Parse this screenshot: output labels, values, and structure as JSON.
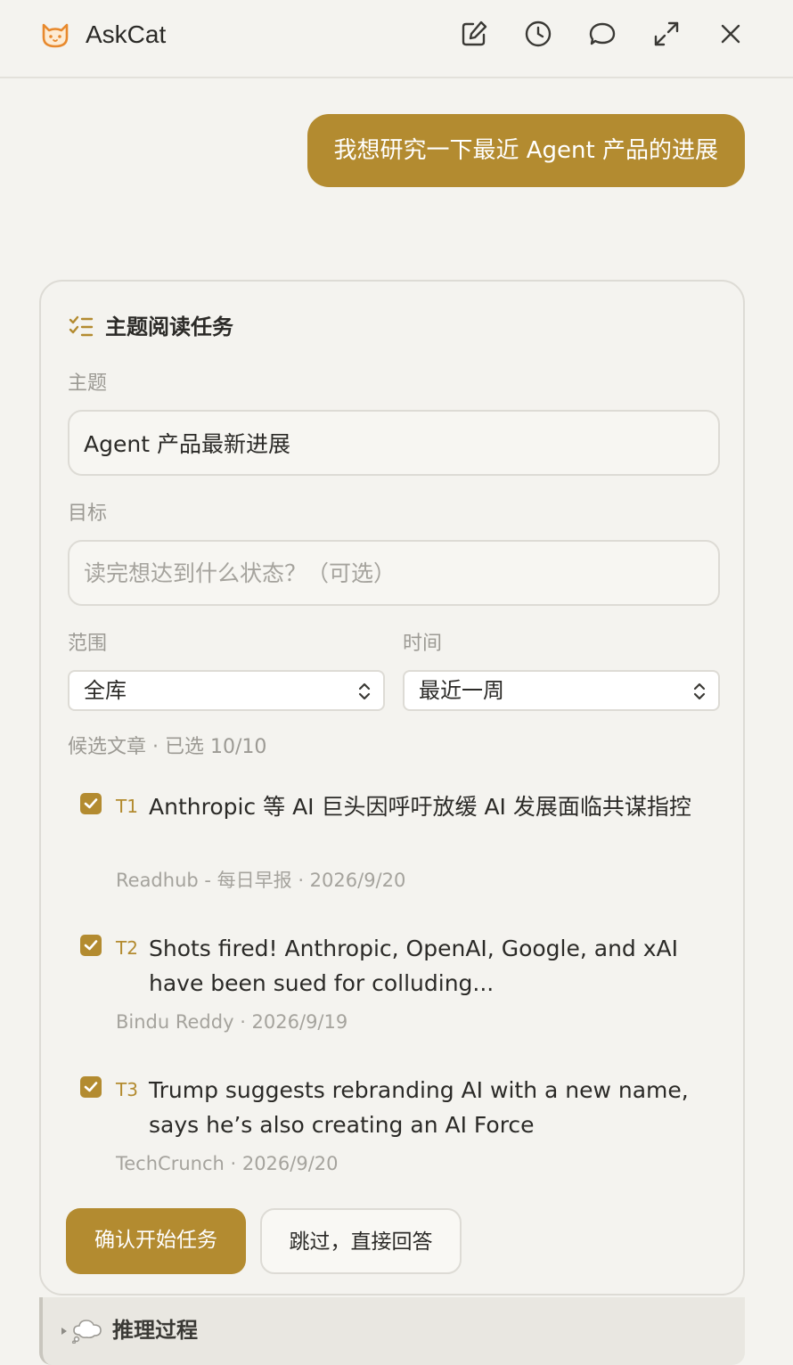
{
  "header": {
    "app_name": "AskCat",
    "icons": [
      "cat-logo-icon",
      "edit-icon",
      "history-icon",
      "chat-icon",
      "expand-icon",
      "close-icon"
    ]
  },
  "user_message": "我想研究一下最近 Agent 产品的进展",
  "task_card": {
    "title": "主题阅读任务",
    "topic_label": "主题",
    "topic_value": "Agent 产品最新进展",
    "goal_label": "目标",
    "goal_placeholder": "读完想达到什么状态？（可选）",
    "scope_label": "范围",
    "scope_value": "全库",
    "time_label": "时间",
    "time_value": "最近一周",
    "candidates_label": "候选文章 · 已选 10/10",
    "articles": [
      {
        "id": "T1",
        "title": "Anthropic 等 AI 巨头因呼吁放缓 AI 发展面临共谋指控",
        "meta": "Readhub - 每日早报 · 2026/9/20",
        "checked": true
      },
      {
        "id": "T2",
        "title": "Shots fired! Anthropic, OpenAI, Google, and xAI have been sued for colluding...",
        "meta": "Bindu Reddy · 2026/9/19",
        "checked": true
      },
      {
        "id": "T3",
        "title": "Trump suggests rebranding AI with a new name, says he’s also creating an AI Force",
        "meta": "TechCrunch · 2026/9/20",
        "checked": true
      }
    ],
    "confirm_label": "确认开始任务",
    "skip_label": "跳过，直接回答"
  },
  "reasoning": {
    "label": "推理过程"
  },
  "colors": {
    "accent": "#b38b30",
    "background": "#f4f3ef",
    "border": "#dddbd5",
    "muted_text": "#9c9a94"
  }
}
